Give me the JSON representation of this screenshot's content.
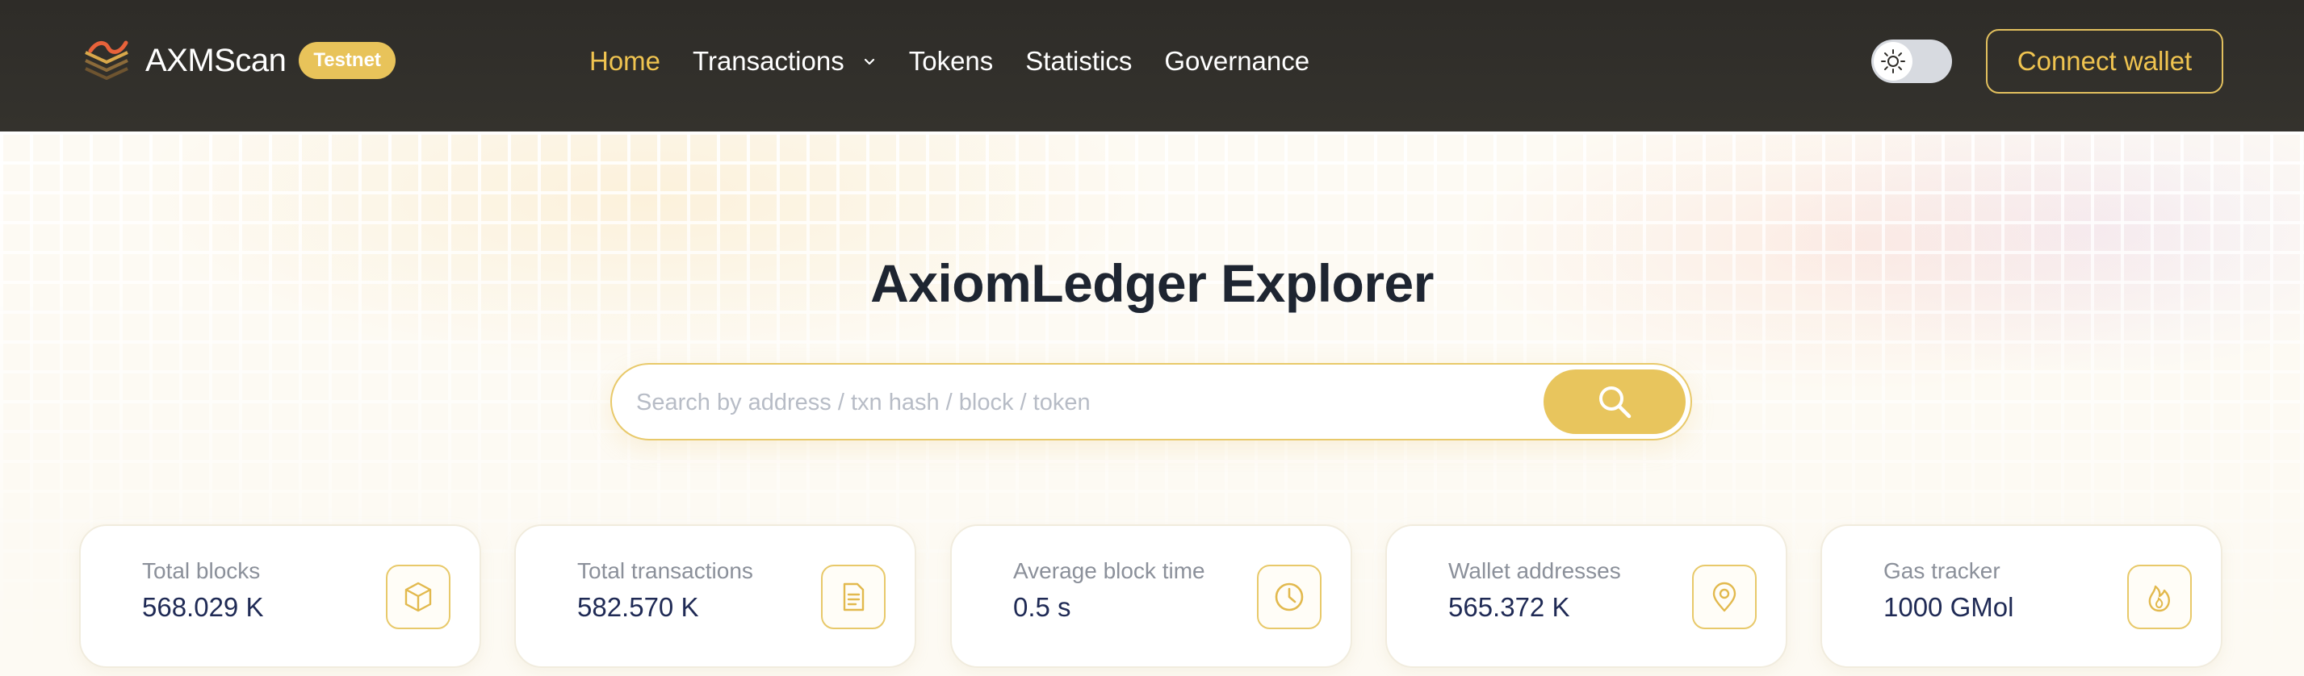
{
  "header": {
    "brand_name": "AXMScan",
    "network_badge": "Testnet",
    "nav": [
      {
        "label": "Home",
        "active": true
      },
      {
        "label": "Transactions",
        "has_dropdown": true
      },
      {
        "label": "Tokens"
      },
      {
        "label": "Statistics"
      },
      {
        "label": "Governance"
      }
    ],
    "theme_toggle_icon": "sun-icon",
    "connect_wallet_label": "Connect wallet"
  },
  "hero": {
    "title": "AxiomLedger Explorer",
    "search_placeholder": "Search by address / txn hash / block / token",
    "search_value": ""
  },
  "stats": [
    {
      "label": "Total blocks",
      "value": "568.029 K",
      "icon": "cube-icon"
    },
    {
      "label": "Total transactions",
      "value": "582.570 K",
      "icon": "document-icon"
    },
    {
      "label": "Average block time",
      "value": "0.5 s",
      "icon": "clock-icon"
    },
    {
      "label": "Wallet addresses",
      "value": "565.372 K",
      "icon": "location-pin-icon"
    },
    {
      "label": "Gas tracker",
      "value": "1000 GMol",
      "icon": "flame-icon"
    }
  ],
  "colors": {
    "accent": "#E8C55D",
    "header_bg": "#2E2C28",
    "active_nav": "#F0C450",
    "title_text": "#1E2531",
    "stat_value": "#1F2A55"
  }
}
